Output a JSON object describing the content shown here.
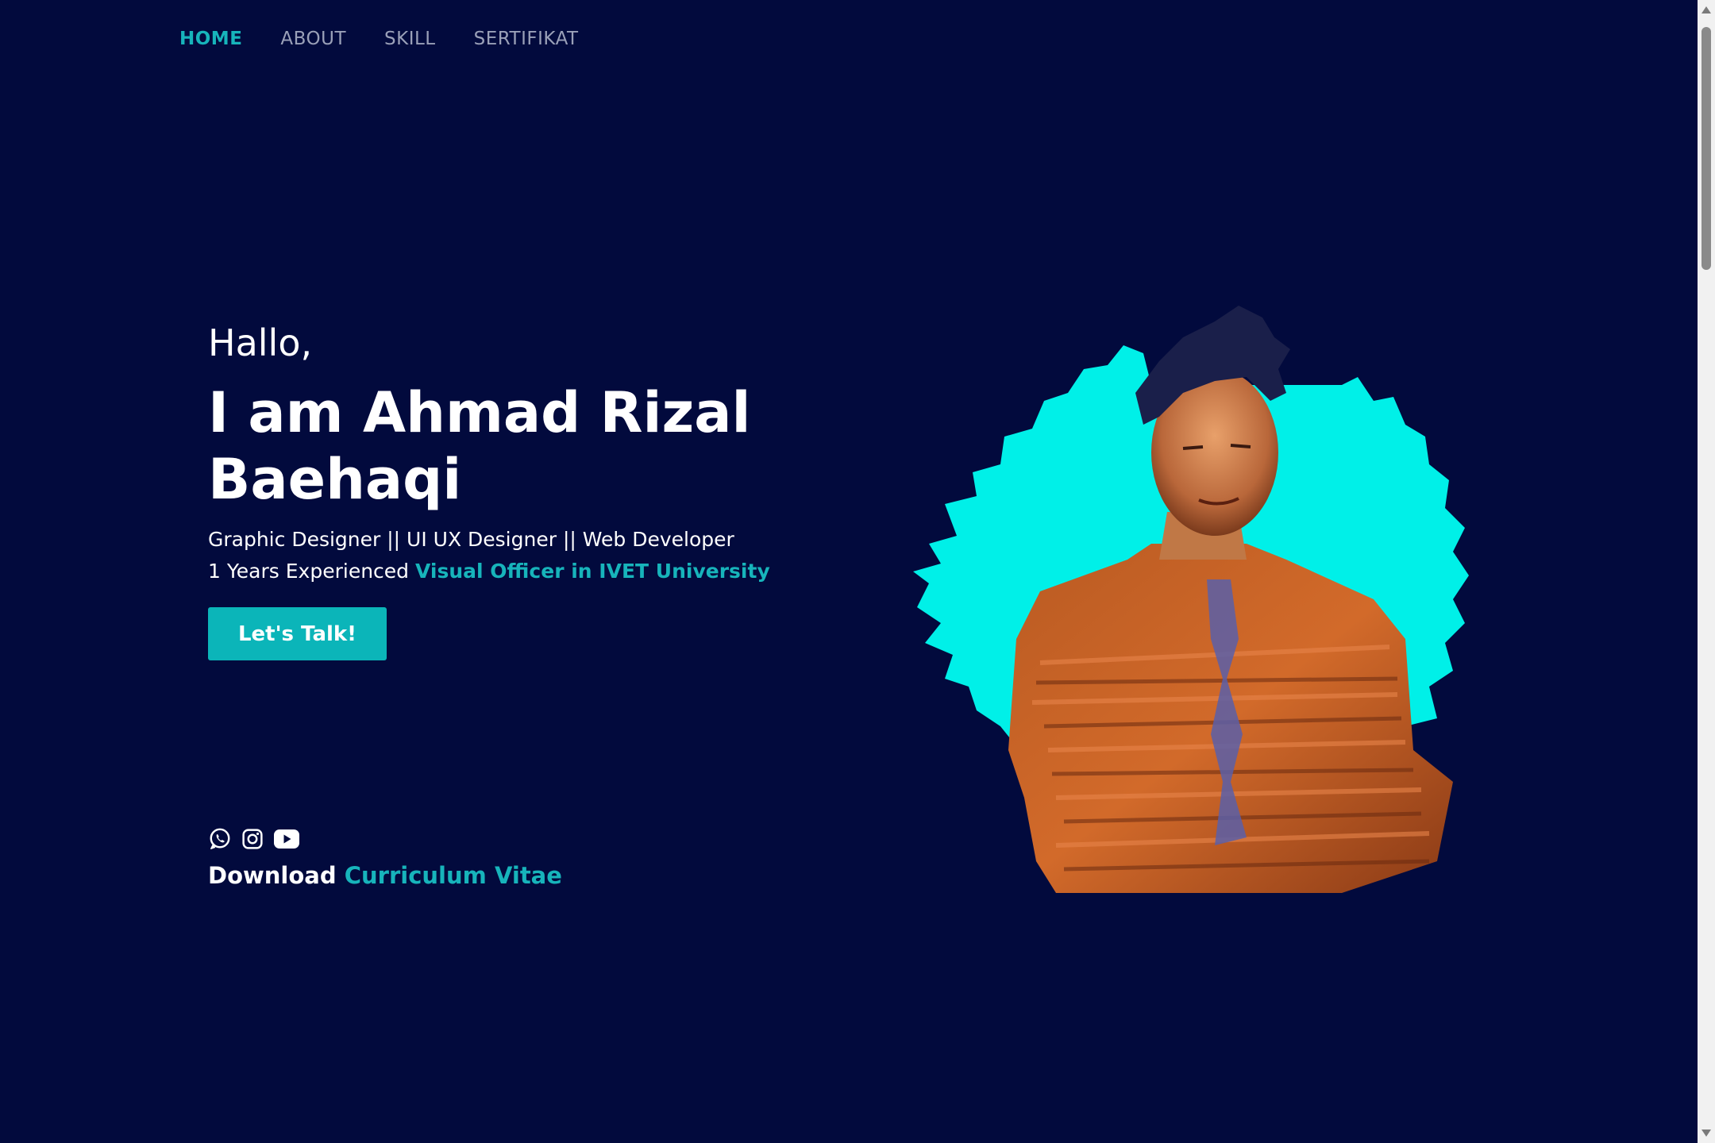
{
  "nav": {
    "items": [
      {
        "label": "HOME",
        "active": true
      },
      {
        "label": "ABOUT",
        "active": false
      },
      {
        "label": "SKILL",
        "active": false
      },
      {
        "label": "SERTIFIKAT",
        "active": false
      }
    ]
  },
  "hero": {
    "greeting": "Hallo,",
    "name": "I am Ahmad Rizal Baehaqi",
    "roles": "Graphic Designer || UI UX Designer || Web Developer",
    "experience_prefix": "1 Years Experienced",
    "experience_highlight": "Visual Officer in IVET University",
    "cta_label": "Let's Talk!"
  },
  "social": {
    "icons": [
      "whatsapp-icon",
      "instagram-icon",
      "youtube-icon"
    ]
  },
  "download": {
    "prefix": "Download",
    "link": "Curriculum Vitae"
  },
  "colors": {
    "background": "#020a3d",
    "accent": "#17b4bb",
    "glow": "#00f0e8",
    "text": "#ffffff",
    "nav_inactive": "#9aa0b8"
  }
}
